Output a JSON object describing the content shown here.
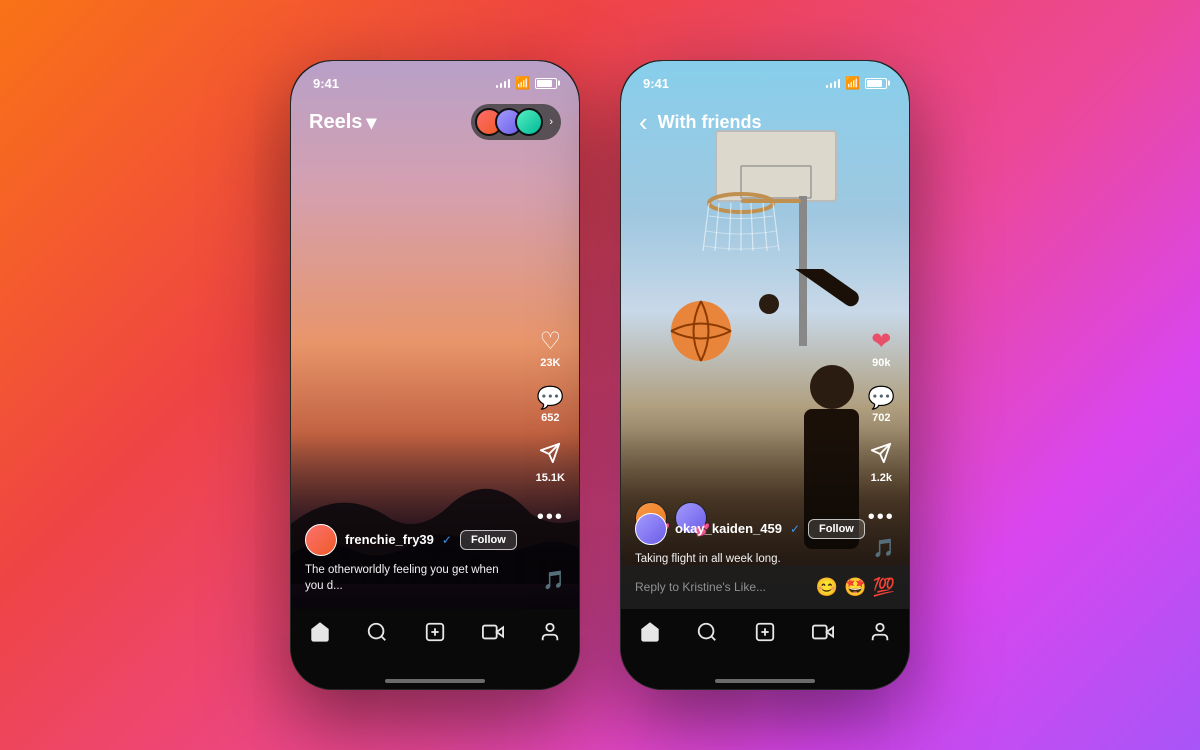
{
  "phones": {
    "phone1": {
      "status": {
        "time": "9:41",
        "signal": true,
        "wifi": true,
        "battery": true
      },
      "nav": {
        "title": "Reels",
        "chevron": "▾"
      },
      "actions": {
        "likes": "23K",
        "comments": "652",
        "shares": "15.1K"
      },
      "user": {
        "username": "frenchie_fry39",
        "verified": true,
        "follow_label": "Follow"
      },
      "caption": "The otherworldly feeling you get when you d...",
      "nav_items": [
        "🏠",
        "🔍",
        "➕",
        "🎬",
        "👤"
      ]
    },
    "phone2": {
      "status": {
        "time": "9:41",
        "signal": true,
        "wifi": true,
        "battery": true
      },
      "nav": {
        "back": "‹",
        "title": "With friends"
      },
      "actions": {
        "likes": "90k",
        "comments": "702",
        "shares": "1.2k"
      },
      "user": {
        "username": "okay_kaiden_459",
        "verified": true,
        "follow_label": "Follow"
      },
      "caption": "Taking flight in all week long.",
      "reply_placeholder": "Reply to Kristine's Like...",
      "reply_emojis": [
        "😊",
        "🤩",
        "💯"
      ],
      "nav_items": [
        "🏠",
        "🔍",
        "➕",
        "🎬",
        "👤"
      ]
    }
  }
}
